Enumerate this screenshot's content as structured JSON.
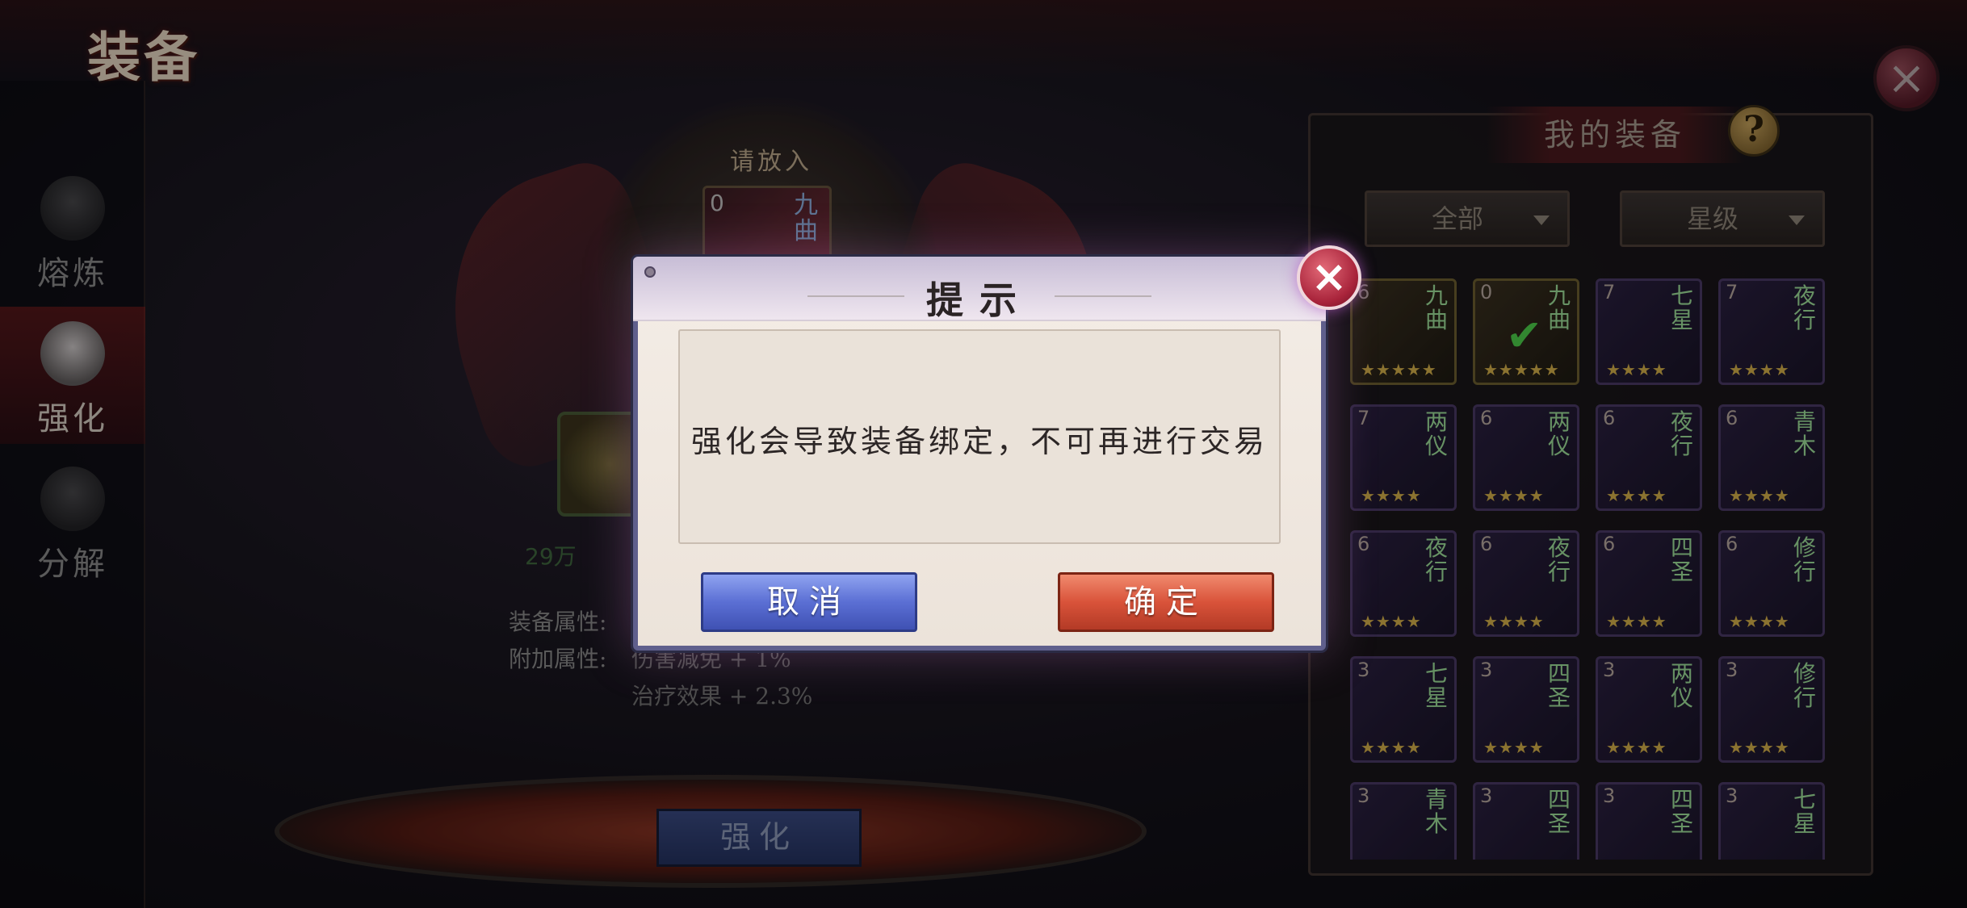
{
  "header": {
    "title": "装备",
    "close_label": "×"
  },
  "sidebar": {
    "items": [
      {
        "label": "熔炼",
        "active": false
      },
      {
        "label": "强化",
        "active": true
      },
      {
        "label": "分解",
        "active": false
      }
    ]
  },
  "stage": {
    "put_label": "请放入",
    "slot_level": "0",
    "slot_name": "九曲",
    "cost_text": "29万",
    "enhance_button": "强化"
  },
  "attributes": {
    "equip_label": "装备属性:",
    "extra_label": "附加属性:",
    "extra_values": [
      "伤害减免 + 1%",
      "治疗效果 + 2.3%"
    ]
  },
  "inventory": {
    "title": "我的装备",
    "help": "?",
    "filter_all": "全部",
    "filter_star": "星级",
    "items": [
      {
        "level": "6",
        "name": "九曲",
        "stars": "★★★★★",
        "selected": false,
        "gold": true
      },
      {
        "level": "0",
        "name": "九曲",
        "stars": "★★★★★",
        "selected": true,
        "gold": true
      },
      {
        "level": "7",
        "name": "七星",
        "stars": "★★★★",
        "selected": false,
        "gold": false
      },
      {
        "level": "7",
        "name": "夜行",
        "stars": "★★★★",
        "selected": false,
        "gold": false
      },
      {
        "level": "7",
        "name": "两仪",
        "stars": "★★★★",
        "selected": false,
        "gold": false
      },
      {
        "level": "6",
        "name": "两仪",
        "stars": "★★★★",
        "selected": false,
        "gold": false
      },
      {
        "level": "6",
        "name": "夜行",
        "stars": "★★★★",
        "selected": false,
        "gold": false
      },
      {
        "level": "6",
        "name": "青木",
        "stars": "★★★★",
        "selected": false,
        "gold": false
      },
      {
        "level": "6",
        "name": "夜行",
        "stars": "★★★★",
        "selected": false,
        "gold": false
      },
      {
        "level": "6",
        "name": "夜行",
        "stars": "★★★★",
        "selected": false,
        "gold": false
      },
      {
        "level": "6",
        "name": "四圣",
        "stars": "★★★★",
        "selected": false,
        "gold": false
      },
      {
        "level": "6",
        "name": "修行",
        "stars": "★★★★",
        "selected": false,
        "gold": false
      },
      {
        "level": "3",
        "name": "七星",
        "stars": "★★★★",
        "selected": false,
        "gold": false
      },
      {
        "level": "3",
        "name": "四圣",
        "stars": "★★★★",
        "selected": false,
        "gold": false
      },
      {
        "level": "3",
        "name": "两仪",
        "stars": "★★★★",
        "selected": false,
        "gold": false
      },
      {
        "level": "3",
        "name": "修行",
        "stars": "★★★★",
        "selected": false,
        "gold": false
      },
      {
        "level": "3",
        "name": "青木",
        "stars": "",
        "selected": false,
        "gold": false
      },
      {
        "level": "3",
        "name": "四圣",
        "stars": "",
        "selected": false,
        "gold": false
      },
      {
        "level": "3",
        "name": "四圣",
        "stars": "",
        "selected": false,
        "gold": false
      },
      {
        "level": "3",
        "name": "七星",
        "stars": "",
        "selected": false,
        "gold": false
      }
    ]
  },
  "dialog": {
    "title": "提示",
    "message": "强化会导致装备绑定，不可再进行交易",
    "cancel_label": "取消",
    "confirm_label": "确定",
    "close_label": "×"
  }
}
